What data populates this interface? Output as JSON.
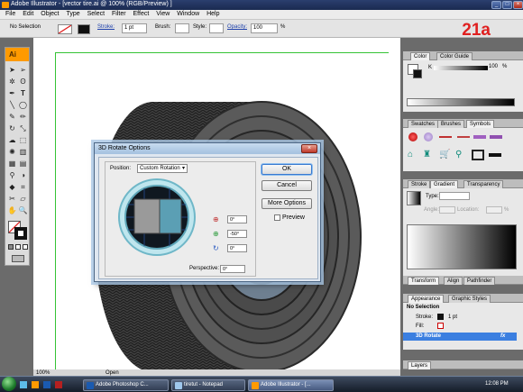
{
  "window": {
    "title": "Adobe Illustrator - [vector tire.ai @ 100% (RGB/Preview) ]"
  },
  "menu": [
    "File",
    "Edit",
    "Object",
    "Type",
    "Select",
    "Filter",
    "Effect",
    "View",
    "Window",
    "Help"
  ],
  "control_bar": {
    "selection": "No Selection",
    "stroke_label": "Stroke:",
    "stroke_value": "1 pt",
    "brush_label": "Brush:",
    "style_label": "Style:",
    "opacity_label": "Opacity:",
    "opacity_value": "100",
    "opacity_unit": "%"
  },
  "step_badge": "21a",
  "dialog": {
    "title": "3D Rotate Options",
    "position_label": "Position:",
    "position_value": "Custom Rotation",
    "x_angle": "0°",
    "y_angle": "-50°",
    "z_angle": "0°",
    "perspective_label": "Perspective:",
    "perspective_value": "0°",
    "ok": "OK",
    "cancel": "Cancel",
    "more_options": "More Options",
    "preview": "Preview"
  },
  "panels": {
    "color_tabs": [
      "Color",
      "Color Guide"
    ],
    "color_k_label": "K",
    "color_k_value": "100",
    "color_k_unit": "%",
    "swatch_tabs": [
      "Swatches",
      "Brushes",
      "Symbols"
    ],
    "stroke_tabs": [
      "Stroke",
      "Gradient",
      "Transparency"
    ],
    "gradient_type_label": "Type:",
    "gradient_angle_label": "Angle:",
    "gradient_location_label": "Location:",
    "gradient_location_unit": "%",
    "transform_tabs": [
      "Transform",
      "Align",
      "Pathfinder"
    ],
    "appearance_tabs": [
      "Appearance",
      "Graphic Styles"
    ],
    "appearance_title": "No Selection",
    "appearance_stroke_label": "Stroke:",
    "appearance_stroke_value": "1 pt",
    "appearance_fill_label": "Fill:",
    "appearance_effect": "3D Rotate",
    "appearance_fx": "fx",
    "layers_tab": "Layers"
  },
  "status": {
    "zoom": "100%",
    "state": "Open"
  },
  "taskbar": {
    "items": [
      "Adobe Photoshop C...",
      "tiretut - Notepad",
      "Adobe Illustrator - [..."
    ],
    "time": "12:08 PM"
  },
  "colors": {
    "accent_orange": "#ff9a00",
    "badge_red": "#e02020",
    "guide_green": "#35c335",
    "selection_blue": "#3b7fe0"
  }
}
